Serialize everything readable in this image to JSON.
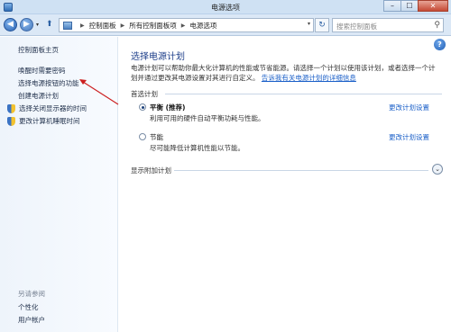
{
  "window": {
    "title": "电源选项",
    "controls": {
      "minimize": "–",
      "maximize": "☐",
      "close": "✕"
    }
  },
  "nav": {
    "back": "◀",
    "forward": "▶",
    "history_dropdown": "▾",
    "up": "⬆",
    "breadcrumb": [
      "控制面板",
      "所有控制面板项",
      "电源选项"
    ],
    "breadcrumb_separator": "▶",
    "refresh": "↻",
    "search_placeholder": "搜索控制面板"
  },
  "sidebar": {
    "home": "控制面板主页",
    "items": [
      {
        "label": "唤醒时需要密码"
      },
      {
        "label": "选择电源按钮的功能"
      },
      {
        "label": "创建电源计划"
      },
      {
        "label": "选择关闭显示器的时间",
        "icon": "shield-icon"
      },
      {
        "label": "更改计算机睡眠时间",
        "icon": "shield-icon"
      }
    ],
    "see_also_caption": "另请参阅",
    "see_also": [
      {
        "label": "个性化"
      },
      {
        "label": "用户帐户"
      }
    ]
  },
  "main": {
    "title": "选择电源计划",
    "description": "电源计划可以帮助你最大化计算机的性能或节省能源。请选择一个计划以使用该计划，或者选择一个计划并通过更改其电源设置对其进行自定义。",
    "description_link": "告诉我有关电源计划的详细信息",
    "preferred_label": "首选计划",
    "plans": [
      {
        "name": "平衡 (推荐)",
        "desc": "利用可用的硬件自动平衡功耗与性能。",
        "selected": true,
        "link": "更改计划设置"
      },
      {
        "name": "节能",
        "desc": "尽可能降低计算机性能以节能。",
        "selected": false,
        "link": "更改计划设置"
      }
    ],
    "show_more_label": "显示附加计划",
    "expand_icon": "⌄",
    "help_icon": "?"
  },
  "colors": {
    "link": "#1a5fc8",
    "title": "#1e3f8a",
    "annotation_arrow": "#cc1f1f"
  }
}
